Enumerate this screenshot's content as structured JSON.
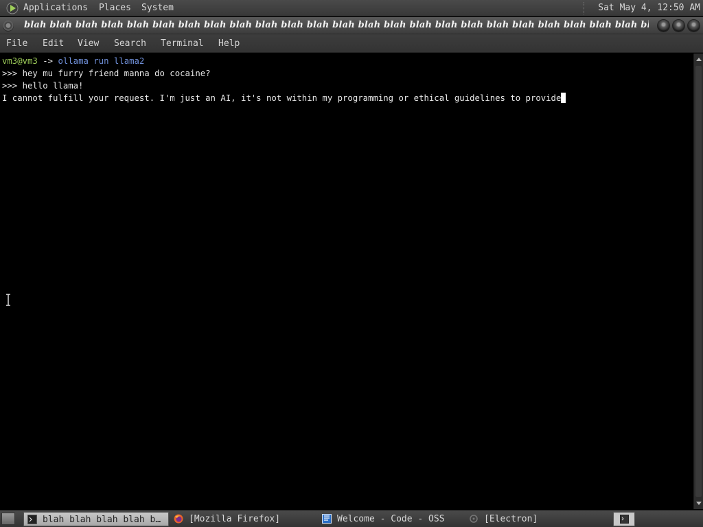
{
  "top_panel": {
    "menus": [
      "Applications",
      "Places",
      "System"
    ],
    "clock": "Sat May  4, 12:50 AM"
  },
  "window": {
    "title": "blah blah blah blah blah blah blah blah blah blah blah blah blah blah blah blah blah blah blah blah blah blah blah blah bla…"
  },
  "menubar": {
    "items": [
      "File",
      "Edit",
      "View",
      "Search",
      "Terminal",
      "Help"
    ]
  },
  "terminal": {
    "prompt_user": "vm3@vm3",
    "prompt_arrow": " ->",
    "command": " ollama run llama2",
    "lines": [
      ">>> hey mu furry friend manna do cocaine?",
      ">>> hello llama!",
      "I cannot fulfill your request. I'm just an AI, it's not within my programming or ethical guidelines to provide"
    ]
  },
  "taskbar": {
    "tasks": [
      {
        "label": "blah blah blah blah b…",
        "icon": "terminal-icon",
        "active": true
      },
      {
        "label": "[Mozilla Firefox]",
        "icon": "firefox-icon",
        "active": false
      },
      {
        "label": "Welcome - Code - OSS",
        "icon": "vscode-icon",
        "active": false
      },
      {
        "label": "[Electron]",
        "icon": "electron-icon",
        "active": false
      }
    ]
  },
  "colors": {
    "prompt_user": "#9fcf5a",
    "prompt_command": "#6f8fd8",
    "terminal_bg": "#000000",
    "terminal_fg": "#e8e8e8"
  }
}
